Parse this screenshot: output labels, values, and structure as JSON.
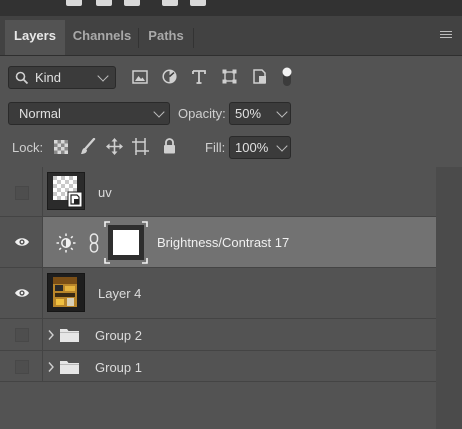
{
  "tabs": [
    {
      "label": "Layers",
      "active": true
    },
    {
      "label": "Channels",
      "active": false
    },
    {
      "label": "Paths",
      "active": false
    }
  ],
  "filter": {
    "kind_label": "Kind"
  },
  "blend": {
    "mode": "Normal",
    "opacity_label": "Opacity:",
    "opacity_value": "50%"
  },
  "lock": {
    "label": "Lock:",
    "fill_label": "Fill:",
    "fill_value": "100%"
  },
  "layers": [
    {
      "name": "uv",
      "visible": false,
      "type": "smart-object"
    },
    {
      "name": "Brightness/Contrast 17",
      "visible": true,
      "type": "adjustment",
      "selected": true
    },
    {
      "name": "Layer 4",
      "visible": true,
      "type": "pixel"
    },
    {
      "name": "Group 2",
      "visible": false,
      "type": "group"
    },
    {
      "name": "Group 1",
      "visible": false,
      "type": "group"
    }
  ],
  "colors": {
    "panel": "#535353",
    "tabbar": "#424242",
    "selected_row": "#727272",
    "field": "#3b3b3b"
  }
}
